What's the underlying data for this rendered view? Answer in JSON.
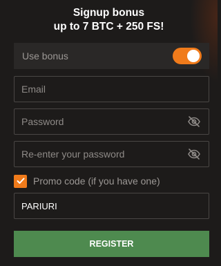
{
  "header": {
    "title_line1": "Signup bonus",
    "title_line2": "up to 7 BTC + 250 FS!"
  },
  "bonus": {
    "label": "Use bonus",
    "enabled": true
  },
  "fields": {
    "email_placeholder": "Email",
    "password_placeholder": "Password",
    "repassword_placeholder": "Re-enter your password"
  },
  "promo": {
    "checkbox_label": "Promo code (if you have one)",
    "checked": true,
    "code_value": "PARIURI"
  },
  "submit": {
    "label": "REGISTER"
  },
  "icons": {
    "password_toggle": "eye-slash-icon",
    "checkbox_mark": "checkmark-icon"
  },
  "colors": {
    "accent": "#f07b1b",
    "submit": "#4e8a4f",
    "background": "#1d1b1a"
  }
}
